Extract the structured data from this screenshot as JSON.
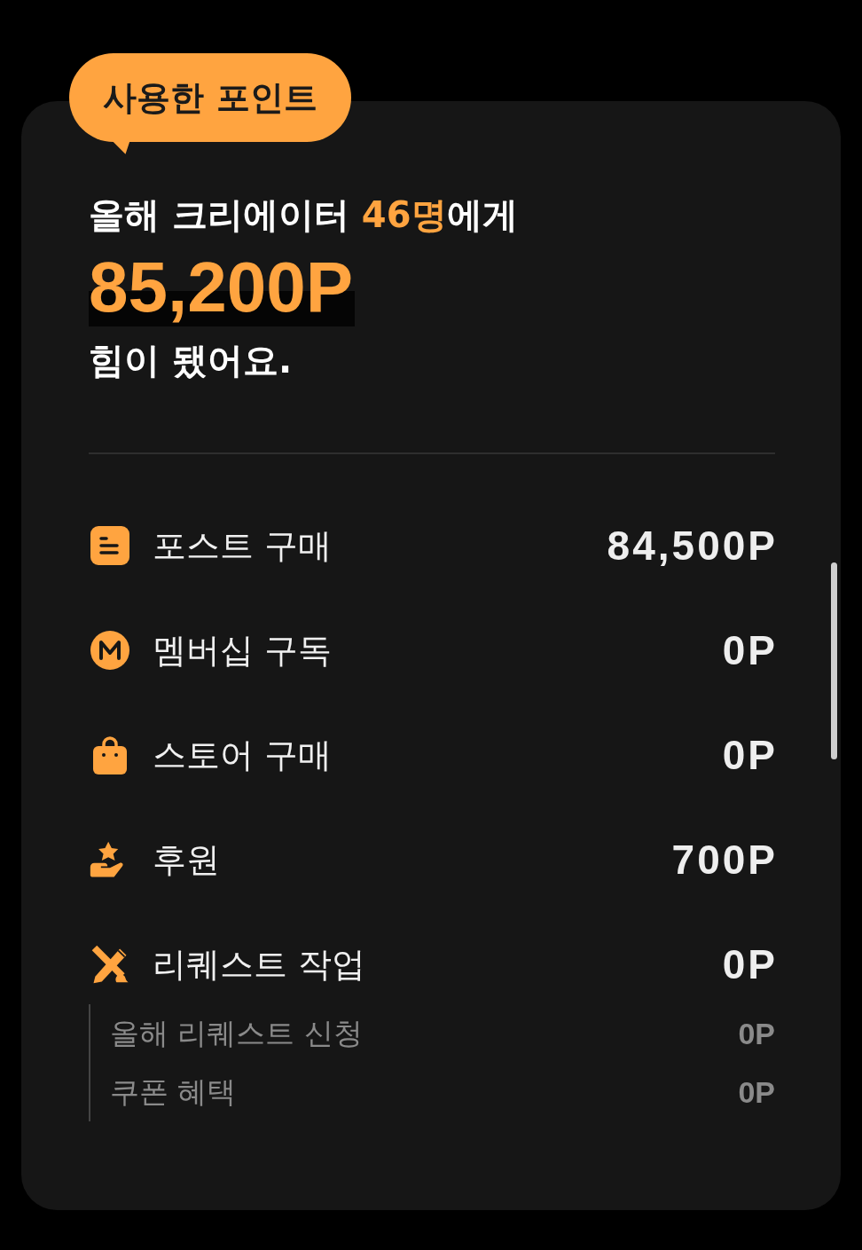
{
  "badge": "사용한 포인트",
  "headline": "올해 크리에이터 **46명**에게",
  "total": "85,200P",
  "subline": "힘이 됐어요.",
  "rows": [
    {
      "kind": "post",
      "label": "포스트 구매",
      "amount": "84,500P"
    },
    {
      "kind": "membership",
      "label": "멤버십 구독",
      "amount": "0P"
    },
    {
      "kind": "store",
      "label": "스토어 구매",
      "amount": "0P"
    },
    {
      "kind": "support",
      "label": "후원",
      "amount": "700P"
    },
    {
      "kind": "request",
      "label": "리퀘스트 작업",
      "amount": "0P",
      "children": [
        {
          "label": "올해 리퀘스트 신청",
          "amount": "0P"
        },
        {
          "label": "쿠폰 혜택",
          "amount": "0P"
        }
      ]
    }
  ]
}
